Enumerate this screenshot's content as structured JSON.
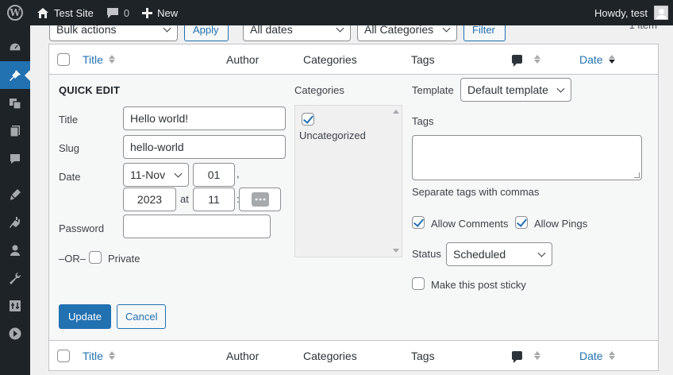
{
  "adminbar": {
    "site_name": "Test Site",
    "comment_count": "0",
    "new_label": "New",
    "howdy": "Howdy, test"
  },
  "tablenav": {
    "bulk_actions": "Bulk actions",
    "apply": "Apply",
    "dates": "All dates",
    "categories": "All Categories",
    "filter": "Filter",
    "items_count": "1 item"
  },
  "columns": {
    "title": "Title",
    "author": "Author",
    "categories": "Categories",
    "tags": "Tags",
    "date": "Date"
  },
  "quick_edit": {
    "legend": "QUICK EDIT",
    "title_label": "Title",
    "title_value": "Hello world!",
    "slug_label": "Slug",
    "slug_value": "hello-world",
    "date_label": "Date",
    "month_value": "11-Nov",
    "day_value": "01",
    "year_value": "2023",
    "at_label": "at",
    "hour_value": "11",
    "comma": ",",
    "colon": ":",
    "password_label": "Password",
    "or_label": "–OR–",
    "private_label": "Private",
    "categories_label": "Categories",
    "category_item": "Uncategorized",
    "category_checked": true,
    "template_label": "Template",
    "template_value": "Default template",
    "tags_label": "Tags",
    "tags_help": "Separate tags with commas",
    "allow_comments": "Allow Comments",
    "allow_pings": "Allow Pings",
    "status_label": "Status",
    "status_value": "Scheduled",
    "sticky_label": "Make this post sticky",
    "update_button": "Update",
    "cancel_button": "Cancel"
  },
  "colors": {
    "admin_bar": "#1d2327",
    "accent": "#2271b1",
    "background": "#f0f0f1"
  },
  "sidebar_icons": [
    "dashboard-icon",
    "posts-icon",
    "media-icon",
    "pages-icon",
    "comments-icon",
    "appearance-icon",
    "plugins-icon",
    "users-icon",
    "tools-icon",
    "settings-icon",
    "collapse-icon"
  ]
}
